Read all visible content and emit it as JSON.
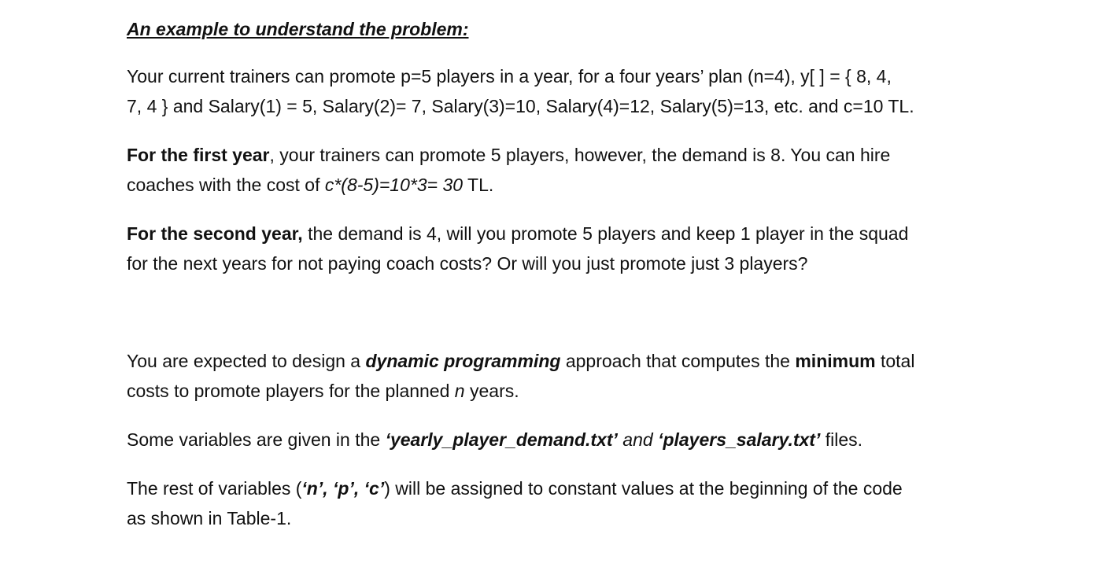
{
  "heading": "An example to understand the problem:",
  "example": {
    "intro": {
      "line1": "Your current trainers can promote p=5 players in a year, for a four years’ plan (n=4), y[ ] = { 8, 4,",
      "line2": "7, 4 } and Salary(1) = 5, Salary(2)= 7, Salary(3)=10, Salary(4)=12, Salary(5)=13, etc. and c=10 TL."
    },
    "first_year": {
      "label": "For the first year",
      "rest_line1": ", your trainers can promote 5 players, however, the demand is 8. You can hire",
      "line2_pre": "coaches with the cost of ",
      "formula": "c*(8-5)=10*3= 30",
      "line2_post": " TL."
    },
    "second_year": {
      "label": "For the second year,",
      "rest_line1": " the demand is 4, will you promote 5 players and keep 1 player in the squad",
      "line2": "for the next years for not paying coach costs? Or will you just promote just 3 players?"
    }
  },
  "task": {
    "dp": {
      "pre": "You are expected to design a ",
      "dp_term": "dynamic programming",
      "mid": " approach that computes the ",
      "min_term": "minimum",
      "post_line1": " total",
      "line2_pre": "costs to promote players for the planned ",
      "n_var": "n",
      "line2_post": " years."
    },
    "files": {
      "pre": "Some variables are given in the ",
      "file1": "‘yearly_player_demand.txt’",
      "and": " and ",
      "file2": "‘players_salary.txt’",
      "post": " files."
    },
    "rest": {
      "pre": "The rest of variables (",
      "vars": "‘n’, ‘p’, ‘c’",
      "post_line1": ") will be assigned to constant values at the beginning of the code",
      "line2": "as shown in Table-1."
    }
  }
}
